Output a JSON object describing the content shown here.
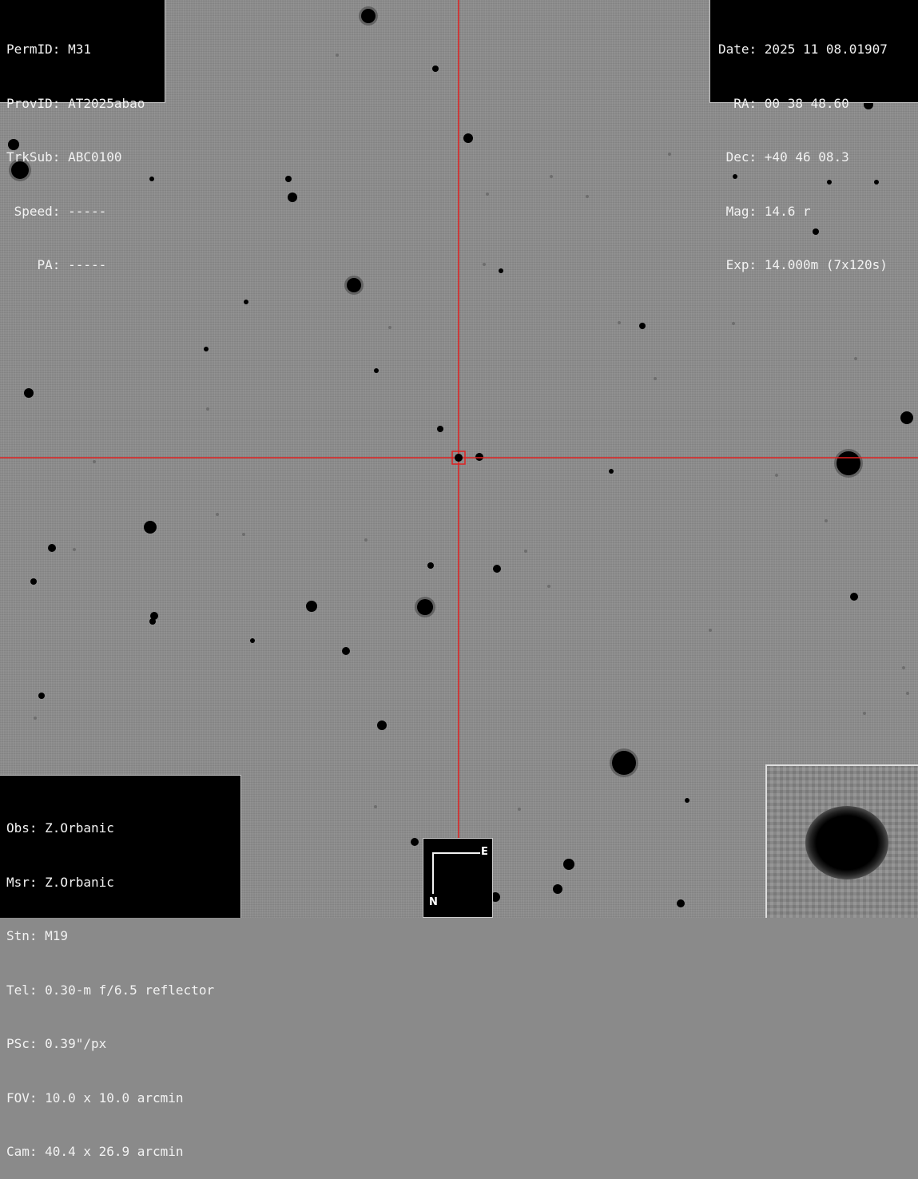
{
  "target_info": {
    "permid": "PermID: M31",
    "provid": "ProvID: AT2025abao",
    "trksub": "TrkSub: ABC0100",
    "speed": " Speed: -----",
    "pa": "    PA: -----"
  },
  "observation": {
    "date": "Date: 2025 11 08.01907",
    "ra": "  RA: 00 38 48.60",
    "dec": " Dec: +40 46 08.3",
    "mag": " Mag: 14.6 r",
    "exp": " Exp: 14.000m (7x120s)"
  },
  "observer": {
    "obs": "Obs: Z.Orbanic",
    "msr": "Msr: Z.Orbanic",
    "stn": "Stn: M19",
    "tel": "Tel: 0.30-m f/6.5 reflector",
    "psc": "PSc: 0.39\"/px",
    "fov": "FOV: 10.0 x 10.0 arcmin",
    "cam": "Cam: 40.4 x 26.9 arcmin"
  },
  "compass": {
    "east": "E",
    "north": "N"
  },
  "colors": {
    "crosshair": "#e02020",
    "sky": "#8c8c8c",
    "star": "#000000"
  }
}
